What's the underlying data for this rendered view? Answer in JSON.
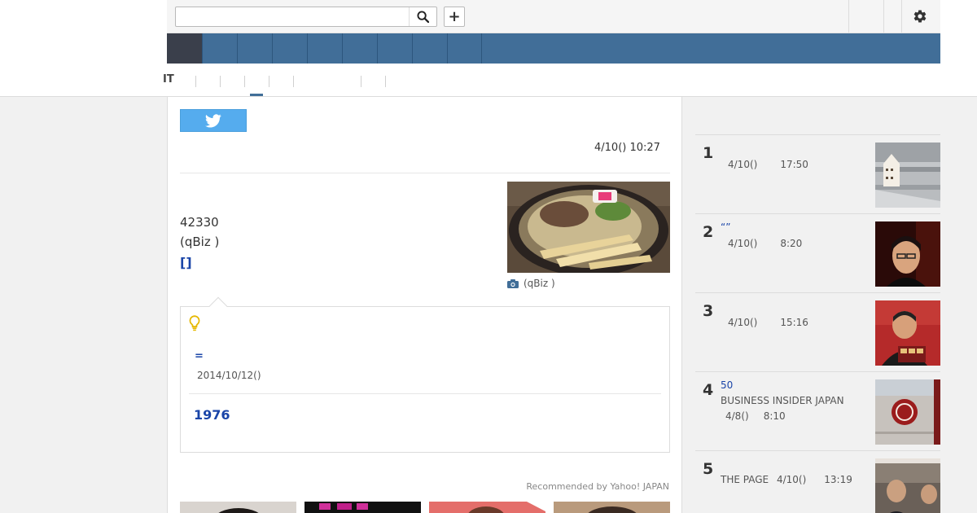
{
  "header": {
    "search": {
      "value": "",
      "placeholder": ""
    },
    "add_label": "+"
  },
  "categories": {
    "visible_label": "IT"
  },
  "article": {
    "datetime": "4/10() 10:27",
    "lead_number": "42330",
    "lead_source": "(qBiz )",
    "lead_link": "[]",
    "photo_caption": "(qBiz )",
    "related": {
      "link": "=",
      "date": "2014/10/12()",
      "link2": "1976"
    },
    "recommended": "Recommended by Yahoo! JAPAN"
  },
  "ranking": [
    {
      "rank": "1",
      "title": "",
      "source": "",
      "date": "4/10()",
      "time": "17:50"
    },
    {
      "rank": "2",
      "title": "“”",
      "source": "",
      "date": "4/10()",
      "time": "8:20"
    },
    {
      "rank": "3",
      "title": "",
      "source": "",
      "date": "4/10()",
      "time": "15:16"
    },
    {
      "rank": "4",
      "title": "50",
      "source": "BUSINESS INSIDER JAPAN",
      "date": "4/8()",
      "time": "8:10"
    },
    {
      "rank": "5",
      "title": "",
      "source": "THE PAGE",
      "date": "4/10()",
      "time": "13:19"
    }
  ],
  "colors": {
    "nav_blue": "#416e98",
    "nav_dark": "#3a3f4b",
    "link_blue": "#1a45a8",
    "twitter": "#55acee"
  },
  "icons": [
    "search-icon",
    "plus-icon",
    "gear-icon",
    "twitter-bird-icon",
    "camera-icon",
    "lightbulb-icon"
  ]
}
